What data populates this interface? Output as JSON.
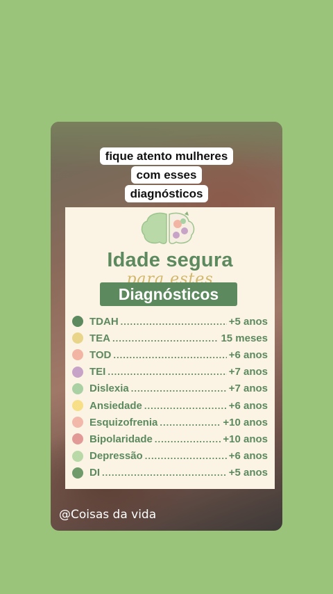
{
  "caption": {
    "lines": [
      "fique atento mulheres",
      "com esses",
      "diagnósticos"
    ]
  },
  "card": {
    "title": "Idade segura",
    "subtitle": "para estes",
    "badge": "Diagnósticos",
    "items": [
      {
        "name": "TDAH",
        "age": "+5 anos",
        "color": "#5c8a5e"
      },
      {
        "name": "TEA",
        "age": "15 meses",
        "color": "#e8d58a"
      },
      {
        "name": "TOD",
        "age": "+6 anos",
        "color": "#f2b5a4"
      },
      {
        "name": "TEI",
        "age": "+7 anos",
        "color": "#c7a3c7"
      },
      {
        "name": "Dislexia",
        "age": "+7 anos",
        "color": "#a9d1a4"
      },
      {
        "name": "Ansiedade",
        "age": "+6 anos",
        "color": "#f6df86"
      },
      {
        "name": "Esquizofrenia",
        "age": "+10 anos",
        "color": "#f2b8aa"
      },
      {
        "name": "Bipolaridade",
        "age": "+10 anos",
        "color": "#e29a97"
      },
      {
        "name": "Depressão",
        "age": "+6 anos",
        "color": "#b9d9a8"
      },
      {
        "name": "DI",
        "age": "+5 anos",
        "color": "#6f9a6a"
      }
    ]
  },
  "handle": "@Coisas da vida"
}
